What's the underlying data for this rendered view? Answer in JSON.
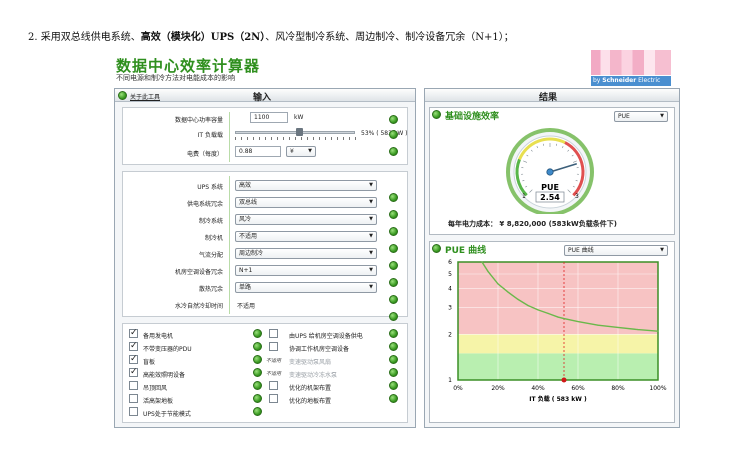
{
  "document": {
    "prefix": "2. 采用双总线供电系统、",
    "bold_part": "高效（模块化）UPS（2N）",
    "suffix": "、风冷型制冷系统、周边制冷、制冷设备冗余（N+1）；"
  },
  "app": {
    "title": "数据中心效率计算器",
    "subtitle": "不同电源和制冷方法对电能成本的影响",
    "logo_text_prefix": "by ",
    "logo_text_brand": "Schneider",
    "logo_text_suffix": " Electric"
  },
  "input_panel": {
    "title": "输入",
    "about_link": "关于此工具",
    "fields": {
      "capacity_label": "数据中心功率容量",
      "capacity_value": "1100",
      "capacity_unit": "kW",
      "it_load_label": "IT 负载载",
      "it_load_readout": "53% ( 583 kW )",
      "it_load_fraction": 0.53,
      "price_label": "电费（每度）",
      "price_value": "0.88",
      "currency_value": "¥"
    },
    "options": [
      {
        "label": "UPS 系统",
        "value": "高效",
        "type": "select"
      },
      {
        "label": "供电系统冗余",
        "value": "双总线",
        "type": "select"
      },
      {
        "label": "制冷系统",
        "value": "风冷",
        "type": "select"
      },
      {
        "label": "制冷机",
        "value": "不适用",
        "type": "select"
      },
      {
        "label": "气流分配",
        "value": "周边制冷",
        "type": "select"
      },
      {
        "label": "机房空调设备冗余",
        "value": "N+1",
        "type": "select"
      },
      {
        "label": "散热冗余",
        "value": "单路",
        "type": "select"
      },
      {
        "label": "水冷自然冷却时间",
        "value": "不适用",
        "type": "text"
      }
    ],
    "checks_left": [
      {
        "label": "备用发电机",
        "checked": true
      },
      {
        "label": "不带变压器的PDU",
        "checked": true
      },
      {
        "label": "盲板",
        "checked": true
      },
      {
        "label": "高能效照明设备",
        "checked": true
      },
      {
        "label": "吊顶回风",
        "checked": false
      },
      {
        "label": "活高架地板",
        "checked": false
      },
      {
        "label": "UPS处于节能模式",
        "checked": false
      }
    ],
    "checks_right": [
      {
        "label": "由UPS 给机房空调设备供电",
        "checked": false,
        "dim": false,
        "na": ""
      },
      {
        "label": "协调工作机房空调设备",
        "checked": false,
        "dim": false,
        "na": ""
      },
      {
        "label": "变速驱动泵风扇",
        "checked": false,
        "dim": true,
        "na": "不适用"
      },
      {
        "label": "变速驱动冷冻水泵",
        "checked": false,
        "dim": true,
        "na": "不适用"
      },
      {
        "label": "优化的机架布置",
        "checked": false,
        "dim": false,
        "na": ""
      },
      {
        "label": "优化的地板布置",
        "checked": false,
        "dim": false,
        "na": ""
      }
    ]
  },
  "result_panel": {
    "title": "结果",
    "efficiency_title": "基础设施效率",
    "metric_select": "PUE",
    "gauge": {
      "label": "PUE",
      "value": "2.54",
      "min_label": "1",
      "max_label": "3",
      "value_num": 2.54,
      "min": 1,
      "max": 3
    },
    "cost_text": "每年电力成本： ¥ 8,820,000 (583kW负载条件下)",
    "curve_title": "PUE 曲线",
    "curve_select": "PUE 曲线"
  },
  "chart_data": {
    "type": "line",
    "title": "PUE 曲线",
    "xlabel": "IT 负载 ( 583 kW )",
    "ylabel": "",
    "xlim": [
      0,
      100
    ],
    "ylim": [
      1,
      6
    ],
    "x_ticks": [
      "0%",
      "20%",
      "40%",
      "60%",
      "80%",
      "100%"
    ],
    "y_ticks": [
      "1",
      "2",
      "3",
      "4",
      "5",
      "6"
    ],
    "y_scale": "log",
    "zones": [
      {
        "from": 1,
        "to": 1.5,
        "color": "#b9efb0"
      },
      {
        "from": 1.5,
        "to": 2,
        "color": "#f6f4a8"
      },
      {
        "from": 2,
        "to": 6,
        "color": "#f7c3c3"
      }
    ],
    "marker_x": 53,
    "series": [
      {
        "values_x": [
          12,
          15,
          20,
          25,
          30,
          35,
          40,
          45,
          50,
          53,
          60,
          70,
          80,
          90,
          100
        ],
        "values_y": [
          6.0,
          5.2,
          4.3,
          3.8,
          3.4,
          3.1,
          2.9,
          2.75,
          2.6,
          2.54,
          2.43,
          2.3,
          2.22,
          2.15,
          2.1
        ],
        "color": "#6ab84a"
      }
    ]
  },
  "colors": {
    "brand_green": "#2f8f1e",
    "accent_blue": "#4a8fd0"
  }
}
